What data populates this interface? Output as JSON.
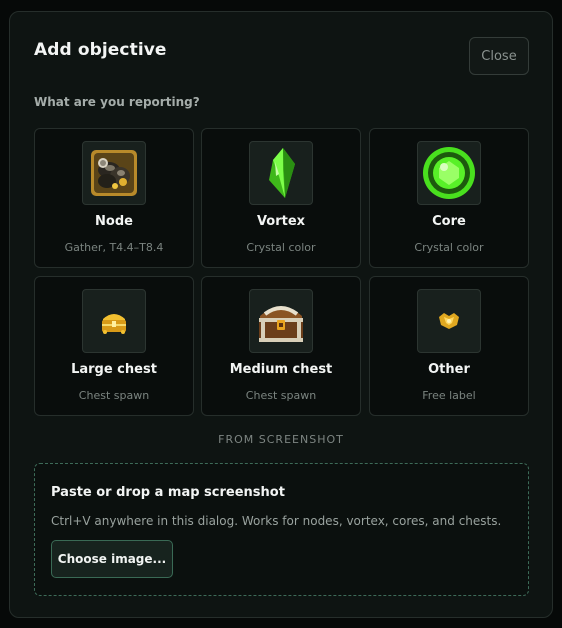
{
  "dialog": {
    "title": "Add objective",
    "close_label": "Close",
    "question": "What are you reporting?"
  },
  "options": [
    {
      "label": "Node",
      "sub": "Gather, T4.4–T8.4",
      "icon": "node-resource-icon"
    },
    {
      "label": "Vortex",
      "sub": "Crystal color",
      "icon": "green-crystal-icon"
    },
    {
      "label": "Core",
      "sub": "Crystal color",
      "icon": "green-core-orb-icon"
    },
    {
      "label": "Large chest",
      "sub": "Chest spawn",
      "icon": "large-gold-chest-icon"
    },
    {
      "label": "Medium chest",
      "sub": "Chest spawn",
      "icon": "medium-chest-icon"
    },
    {
      "label": "Other",
      "sub": "Free label",
      "icon": "gold-emblem-icon"
    }
  ],
  "screenshot": {
    "section_label": "FROM SCREENSHOT",
    "title": "Paste or drop a map screenshot",
    "description": "Ctrl+V anywhere in this dialog. Works for nodes, vortex, cores, and chests.",
    "button_label": "Choose image..."
  },
  "colors": {
    "background": "#0e1412",
    "card": "#090d0c",
    "accent_border": "#3d6b58",
    "crystal_green": "#5cdc2a"
  }
}
